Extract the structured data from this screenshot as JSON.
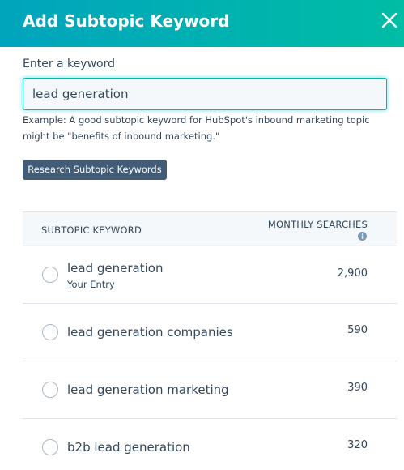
{
  "dialog": {
    "title": "Add Subtopic Keyword"
  },
  "form": {
    "label": "Enter a keyword",
    "input_value": "lead generation",
    "help_text": "Example: A good subtopic keyword for HubSpot's inbound marketing topic might be \"benefits of inbound marketing.\"",
    "button_label": "Research Subtopic Keywords"
  },
  "table": {
    "col_keyword": "SUBTOPIC KEYWORD",
    "col_searches": "MONTHLY SEARCHES",
    "rows": [
      {
        "keyword": "lead generation",
        "note": "Your Entry",
        "searches": "2,900",
        "selected": false
      },
      {
        "keyword": "lead generation companies",
        "searches": "590",
        "selected": false
      },
      {
        "keyword": "lead generation marketing",
        "searches": "390",
        "selected": false
      },
      {
        "keyword": "b2b lead generation",
        "searches": "320",
        "selected": false
      }
    ]
  },
  "icons": {
    "close": "close-icon",
    "info": "info-icon"
  },
  "colors": {
    "header_gradient_start": "#00a4bd",
    "header_gradient_end": "#00bda5",
    "button": "#425b76",
    "text": "#33475b",
    "table_header_bg": "#f5f8fa"
  }
}
